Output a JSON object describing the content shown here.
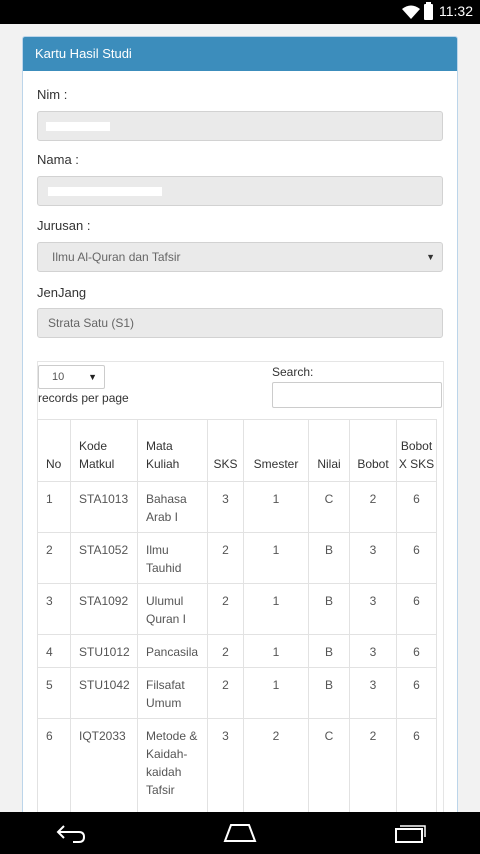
{
  "status_bar": {
    "time": "11:32"
  },
  "panel": {
    "title": "Kartu Hasil Studi",
    "nim_label": "Nim :",
    "nama_label": "Nama :",
    "jurusan_label": "Jurusan :",
    "jurusan_value": "Ilmu Al-Quran dan Tafsir",
    "jenjang_label": "JenJang",
    "jenjang_value": "Strata Satu (S1)"
  },
  "datatable": {
    "page_length": "10",
    "records_per_page": "records per page",
    "search_label": "Search:",
    "search_value": "",
    "headers": {
      "no": "No",
      "kode": "Kode Matkul",
      "mata": "Mata Kuliah",
      "sks": "SKS",
      "semester": "Smester",
      "nilai": "Nilai",
      "bobot": "Bobot",
      "bobot_sks": "Bobot X SKS"
    },
    "rows": [
      {
        "no": "1",
        "kode": "STA1013",
        "mata": "Bahasa Arab I",
        "sks": "3",
        "semester": "1",
        "nilai": "C",
        "bobot": "2",
        "bobot_sks": "6"
      },
      {
        "no": "2",
        "kode": "STA1052",
        "mata": "Ilmu Tauhid",
        "sks": "2",
        "semester": "1",
        "nilai": "B",
        "bobot": "3",
        "bobot_sks": "6"
      },
      {
        "no": "3",
        "kode": "STA1092",
        "mata": "Ulumul Quran I",
        "sks": "2",
        "semester": "1",
        "nilai": "B",
        "bobot": "3",
        "bobot_sks": "6"
      },
      {
        "no": "4",
        "kode": "STU1012",
        "mata": "Pancasila",
        "sks": "2",
        "semester": "1",
        "nilai": "B",
        "bobot": "3",
        "bobot_sks": "6"
      },
      {
        "no": "5",
        "kode": "STU1042",
        "mata": "Filsafat Umum",
        "sks": "2",
        "semester": "1",
        "nilai": "B",
        "bobot": "3",
        "bobot_sks": "6"
      },
      {
        "no": "6",
        "kode": "IQT2033",
        "mata": "Metode & Kaidah-kaidah Tafsir",
        "sks": "3",
        "semester": "2",
        "nilai": "C",
        "bobot": "2",
        "bobot_sks": "6"
      }
    ]
  },
  "colors": {
    "accent": "#3c8dbc",
    "statusbar": "#000000"
  },
  "icons": [
    "wifi-icon",
    "battery-icon",
    "dropdown-caret-icon",
    "back-icon",
    "home-icon",
    "recents-icon"
  ]
}
